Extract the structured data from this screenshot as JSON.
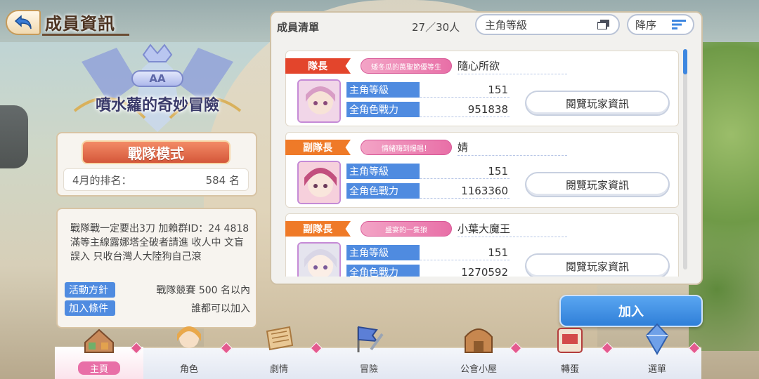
{
  "header": {
    "title": "成員資訊"
  },
  "clan": {
    "rank_badge": "AA",
    "name": "噴水蘿的奇妙冒險",
    "mode": "戰隊模式",
    "ranking_label": "4月的排名：",
    "ranking_value": "584 名",
    "description": "戰隊戰一定要出3刀  加賴群ID：24 4818  滿等主線露娜塔全破者請進  收人中  文盲誤入  只收台灣人大陸狗自己滾",
    "policy": {
      "label": "活動方針",
      "value": "戰隊競賽 500 名以內"
    },
    "join_condition": {
      "label": "加入條件",
      "value": "誰都可以加入"
    }
  },
  "member_list": {
    "title": "成員清單",
    "count": "27／30人",
    "sort_value": "主角等級",
    "order_label": "降序",
    "stat_labels": {
      "level": "主角等級",
      "power": "全角色戰力"
    },
    "view_button": "閱覽玩家資訊",
    "members": [
      {
        "role": "隊長",
        "title": "矮冬瓜的萬聖節優等生",
        "name": "隨心所欲",
        "level": "151",
        "power": "951838"
      },
      {
        "role": "副隊長",
        "title": "情緒嗨到爆唱！",
        "name": "婧",
        "level": "151",
        "power": "1163360"
      },
      {
        "role": "副隊長",
        "title": "盛宴的一隻狼",
        "name": "小葉大魔王",
        "level": "151",
        "power": "1270592"
      }
    ]
  },
  "join_button": "加入",
  "nav": {
    "items": [
      {
        "label": "主頁",
        "icon": "home-icon"
      },
      {
        "label": "角色",
        "icon": "character-icon"
      },
      {
        "label": "劇情",
        "icon": "story-icon"
      },
      {
        "label": "冒險",
        "icon": "adventure-icon"
      },
      {
        "label": "公會小屋",
        "icon": "guild-house-icon"
      },
      {
        "label": "轉蛋",
        "icon": "gacha-icon"
      },
      {
        "label": "選單",
        "icon": "menu-crystal-icon"
      }
    ]
  },
  "colors": {
    "accent_blue": "#4f8be0",
    "leader_red": "#e3452c",
    "sub_leader_orange": "#ef7a28",
    "nav_pink": "#e86fa7"
  }
}
